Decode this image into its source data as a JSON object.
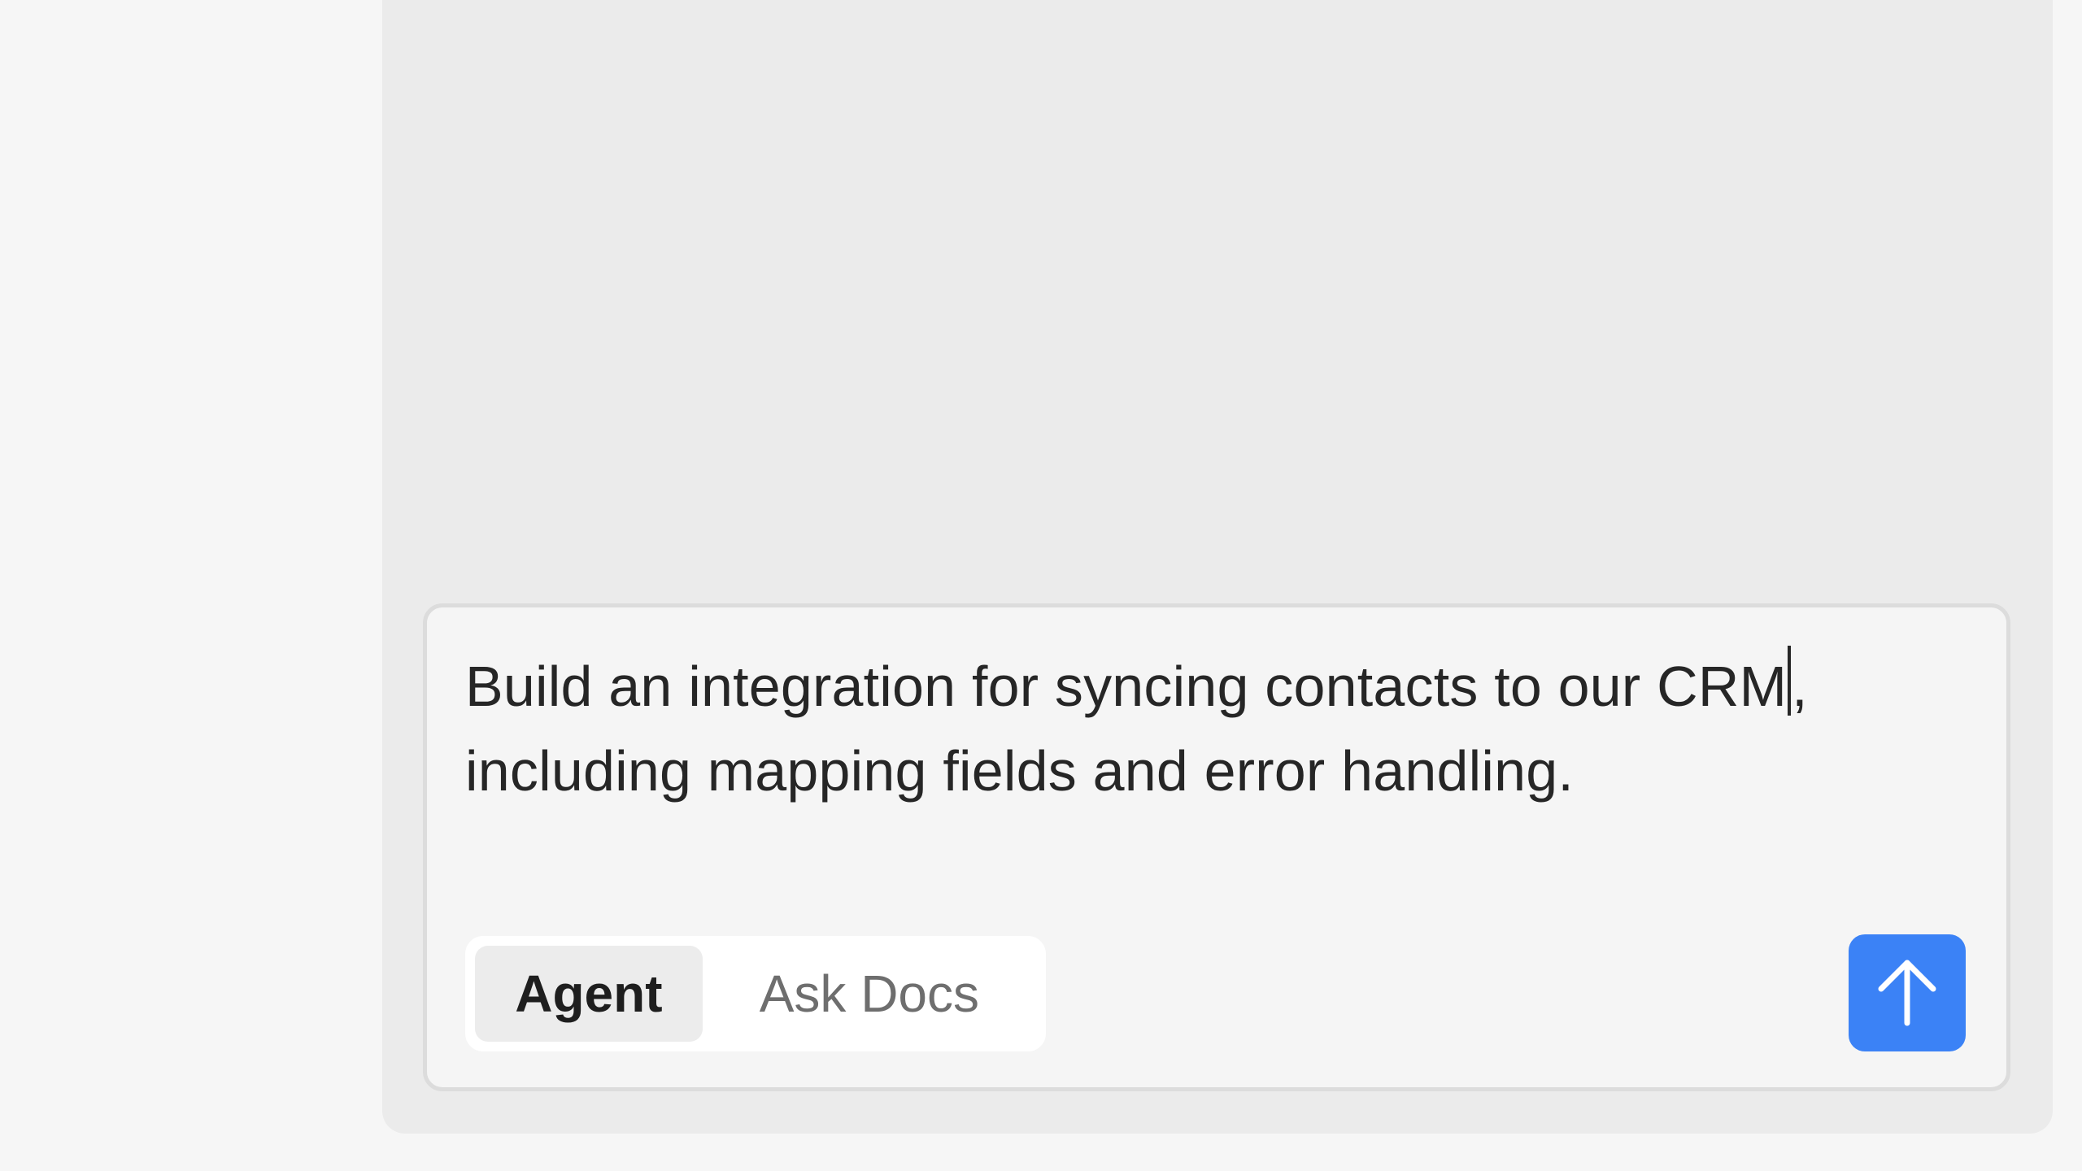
{
  "composer": {
    "text_before_caret": "Build an integration for syncing contacts to our CRM",
    "text_after_caret": ",\nincluding mapping fields and error handling."
  },
  "mode_toggle": {
    "options": [
      {
        "label": "Agent",
        "active": true
      },
      {
        "label": "Ask Docs",
        "active": false
      }
    ]
  },
  "send_button": {
    "icon": "arrow-up-icon",
    "color": "#3b82f6"
  },
  "colors": {
    "page_background": "#f6f6f6",
    "panel_background": "#ebebeb",
    "composer_background": "#f5f5f5",
    "accent": "#3b82f6"
  }
}
